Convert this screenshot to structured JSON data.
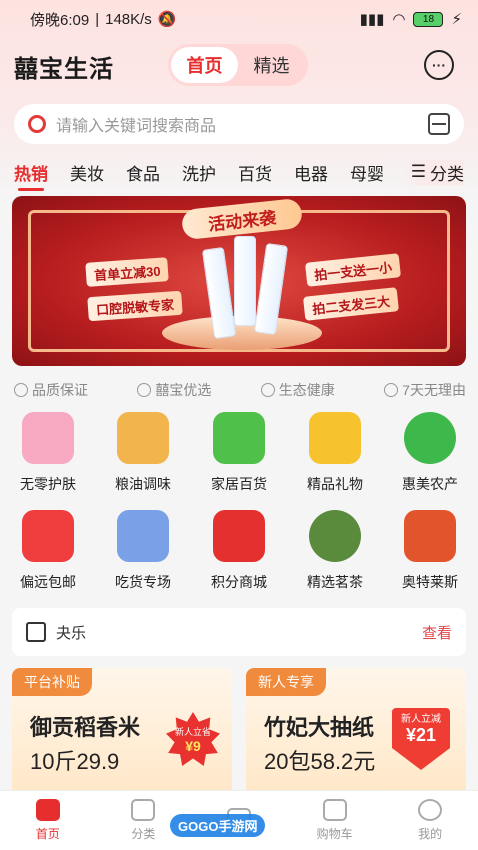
{
  "status_bar": {
    "time": "傍晚6:09",
    "network_speed": "148K/s",
    "battery": "18"
  },
  "header": {
    "logo": "囍宝生活",
    "tabs": [
      {
        "label": "首页",
        "active": true
      },
      {
        "label": "精选",
        "active": false
      }
    ],
    "chat_icon": "chat-bubble-icon"
  },
  "search": {
    "placeholder": "请输入关键词搜索商品"
  },
  "categories": {
    "items": [
      "热销",
      "美妆",
      "食品",
      "洗护",
      "百货",
      "电器",
      "母婴"
    ],
    "active": "热销",
    "all_label": "分类"
  },
  "banner": {
    "title": "活动来袭",
    "tags": [
      "首单立减30",
      "口腔脱敏专家",
      "拍一支送一小",
      "拍二支发三大"
    ]
  },
  "features": [
    "品质保证",
    "囍宝优选",
    "生态健康",
    "7天无理由"
  ],
  "grid": [
    {
      "label": "无零护肤",
      "icon": "skincare-icon",
      "color": "#f6a9c0"
    },
    {
      "label": "粮油调味",
      "icon": "grain-oil-icon",
      "color": "#f2b44c"
    },
    {
      "label": "家居百货",
      "icon": "basket-icon",
      "color": "#4fc14a"
    },
    {
      "label": "精品礼物",
      "icon": "gift-icon",
      "color": "#f6c22e"
    },
    {
      "label": "惠美农产",
      "icon": "tree-icon",
      "color": "#3fb84b"
    },
    {
      "label": "偏远包邮",
      "icon": "shopping-bag-icon",
      "color": "#ef3c3c"
    },
    {
      "label": "吃货专场",
      "icon": "snacks-icon",
      "color": "#7aa0e8"
    },
    {
      "label": "积分商城",
      "icon": "red-envelope-icon",
      "color": "#e53030"
    },
    {
      "label": "精选茗茶",
      "icon": "tea-leaf-icon",
      "color": "#5a8a3c"
    },
    {
      "label": "奥特莱斯",
      "icon": "outlet-icon",
      "color": "#e2552c"
    }
  ],
  "notice": {
    "text": "夬乐",
    "more": "查看"
  },
  "promos": [
    {
      "badge": "平台补贴",
      "title": "御贡稻香米",
      "price": "10斤29.9",
      "burst_top": "新人立省",
      "burst_value": "¥9"
    },
    {
      "badge": "新人专享",
      "title": "竹妃大抽纸",
      "price": "20包58.2元",
      "burst_top": "新人立减",
      "burst_value": "¥21"
    }
  ],
  "tabbar": [
    {
      "label": "首页",
      "icon": "home-icon",
      "active": true
    },
    {
      "label": "分类",
      "icon": "category-icon",
      "active": false
    },
    {
      "label": "",
      "icon": "calendar-icon",
      "active": false
    },
    {
      "label": "购物车",
      "icon": "cart-icon",
      "active": false
    },
    {
      "label": "我的",
      "icon": "profile-icon",
      "active": false
    }
  ],
  "watermark": "GOGO手游网"
}
